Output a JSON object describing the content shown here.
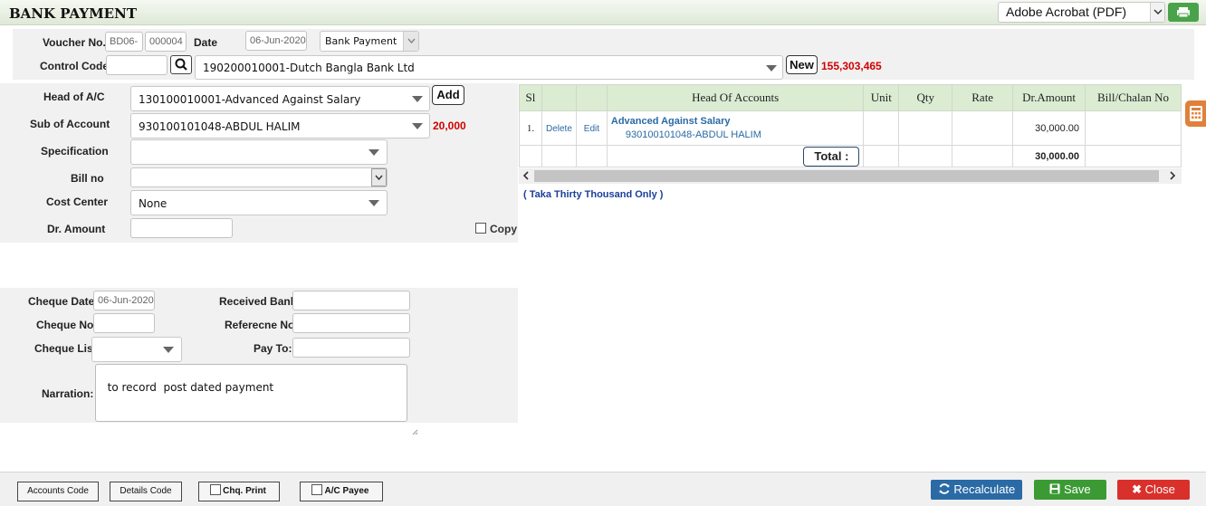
{
  "header": {
    "title": "BANK PAYMENT",
    "print_format": "Adobe Acrobat (PDF)"
  },
  "voucher": {
    "voucher_no_label": "Voucher No.",
    "voucher_prefix": "BD06-",
    "voucher_number": "000004",
    "date_label": "Date",
    "date_value": "06-Jun-2020",
    "type_value": "Bank Payment",
    "control_code_label": "Control Code",
    "control_code_value": "",
    "bank_account": "190200010001-Dutch Bangla Bank Ltd",
    "new_label": "New",
    "bank_balance": "155,303,465"
  },
  "entry": {
    "head_label": "Head of A/C",
    "head_value": "130100010001-Advanced Against Salary",
    "add_label": "Add",
    "sub_label": "Sub of Account",
    "sub_value": "930100101048-ABDUL HALIM",
    "sub_balance": "20,000",
    "spec_label": "Specification",
    "spec_value": "",
    "bill_label": "Bill no",
    "bill_value": "",
    "cost_label": "Cost Center",
    "cost_value": "None",
    "amount_label": "Dr. Amount",
    "amount_value": "",
    "copy_label": "Copy"
  },
  "cheque": {
    "date_label": "Cheque Date",
    "date_value": "06-Jun-2020",
    "no_label": "Cheque No",
    "no_value": "",
    "list_label": "Cheque List",
    "list_value": "",
    "received_bank_label": "Received Bank",
    "received_bank_value": "",
    "reference_label": "Referecne No",
    "reference_value": "",
    "payto_label": "Pay To:",
    "payto_value": "",
    "narration_label": "Narration:",
    "narration_value": "to record  post dated payment"
  },
  "grid": {
    "columns": [
      "Sl",
      "",
      "",
      "Head Of Accounts",
      "Unit",
      "Qty",
      "Rate",
      "Dr.Amount",
      "Bill/Chalan No"
    ],
    "rows": [
      {
        "sl": "1.",
        "delete": "Delete",
        "edit": "Edit",
        "head": "Advanced Against Salary",
        "sub": "930100101048-ABDUL HALIM",
        "unit": "",
        "qty": "",
        "rate": "",
        "amount": "30,000.00",
        "bill": ""
      }
    ],
    "total_label": "Total :",
    "total_amount": "30,000.00",
    "in_words": "( Taka Thirty Thousand Only )"
  },
  "footer": {
    "accounts_code": "Accounts Code",
    "details_code": "Details Code",
    "chq_print": "Chq. Print",
    "ac_payee": "A/C Payee",
    "recalculate": "Recalculate",
    "save": "Save",
    "close": "Close"
  },
  "colors": {
    "balance_red": "#d10000",
    "recalc_blue": "#2a6aa5",
    "save_green": "#3c9a34",
    "close_red": "#d9302c",
    "header_green": "#dbecd2"
  }
}
